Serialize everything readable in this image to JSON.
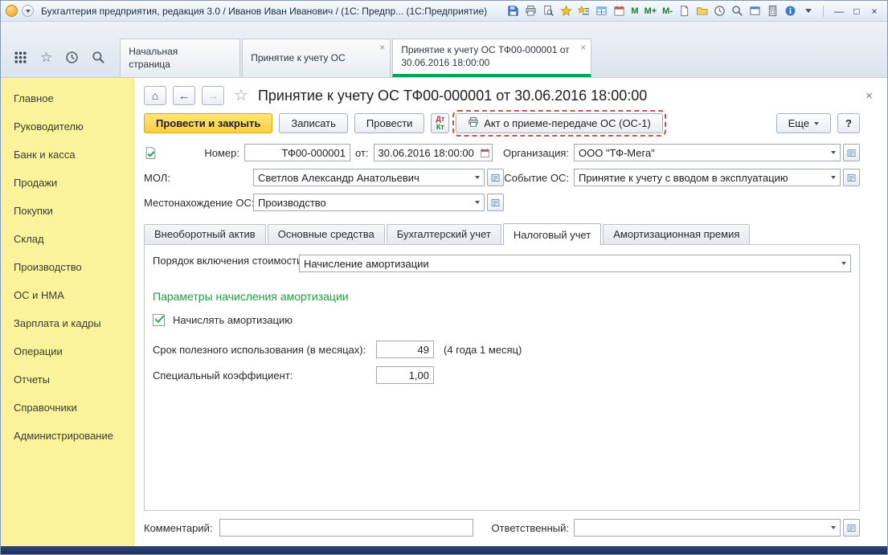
{
  "titlebar": {
    "title": "Бухгалтерия предприятия, редакция 3.0 / Иванов Иван Иванович / (1С: Предпр...  (1С:Предприятие)",
    "memory_buttons": [
      "M",
      "M+",
      "M-"
    ]
  },
  "icons": {
    "home": "⌂",
    "back": "←",
    "forward": "→",
    "star_outline": "☆",
    "close": "×",
    "minimize": "—",
    "maximize": "□"
  },
  "nav_tabs": [
    {
      "label": "Начальная страница"
    },
    {
      "label": "Принятие к учету ОС"
    },
    {
      "label": "Принятие к учету ОС ТФ00-000001 от 30.06.2016 18:00:00"
    }
  ],
  "sidebar": {
    "items": [
      "Главное",
      "Руководителю",
      "Банк и касса",
      "Продажи",
      "Покупки",
      "Склад",
      "Производство",
      "ОС и НМА",
      "Зарплата и кадры",
      "Операции",
      "Отчеты",
      "Справочники",
      "Администрирование"
    ]
  },
  "doc": {
    "title": "Принятие к учету ОС ТФ00-000001 от 30.06.2016 18:00:00",
    "toolbar": {
      "post_and_close": "Провести и закрыть",
      "write": "Записать",
      "post": "Провести",
      "dt": "Дт",
      "kt": "Кт",
      "print_act": "Акт о приеме-передаче ОС (ОС-1)",
      "more": "Еще",
      "help": "?"
    },
    "header_fields": {
      "number_label": "Номер:",
      "number_value": "ТФ00-000001",
      "date_label": "от:",
      "date_value": "30.06.2016 18:00:00",
      "org_label": "Организация:",
      "org_value": "ООО \"ТФ-Мега\"",
      "mol_label": "МОЛ:",
      "mol_value": "Светлов Александр Анатольевич",
      "event_label": "Событие ОС:",
      "event_value": "Принятие к учету с вводом в эксплуатацию",
      "location_label": "Местонахождение ОС:",
      "location_value": "Производство"
    },
    "form_tabs": [
      "Внеоборотный актив",
      "Основные средства",
      "Бухгалтерский учет",
      "Налоговый учет",
      "Амортизационная премия"
    ],
    "active_form_tab": "Налоговый учет",
    "tax_page": {
      "order_label": "Порядок включения стоимости в состав расходов:",
      "order_value": "Начисление амортизации",
      "section_heading": "Параметры начисления амортизации",
      "accrue_checkbox_label": "Начислять амортизацию",
      "accrue_checked": true,
      "useful_life_label": "Срок полезного использования (в месяцах):",
      "useful_life_value": "49",
      "useful_life_hint": "(4 года 1 месяц)",
      "coefficient_label": "Специальный коэффициент:",
      "coefficient_value": "1,00"
    },
    "footer": {
      "comment_label": "Комментарий:",
      "comment_value": "",
      "responsible_label": "Ответственный:",
      "responsible_value": ""
    }
  },
  "colors": {
    "active_tab_green": "#00a651",
    "primary_button_yellow": "#fecf3e",
    "sidebar_yellow": "#fbf39c",
    "section_heading_green": "#1e9e3e",
    "highlight_dashed_red": "#d94f43",
    "bottom_bar_navy": "#1f3260"
  }
}
